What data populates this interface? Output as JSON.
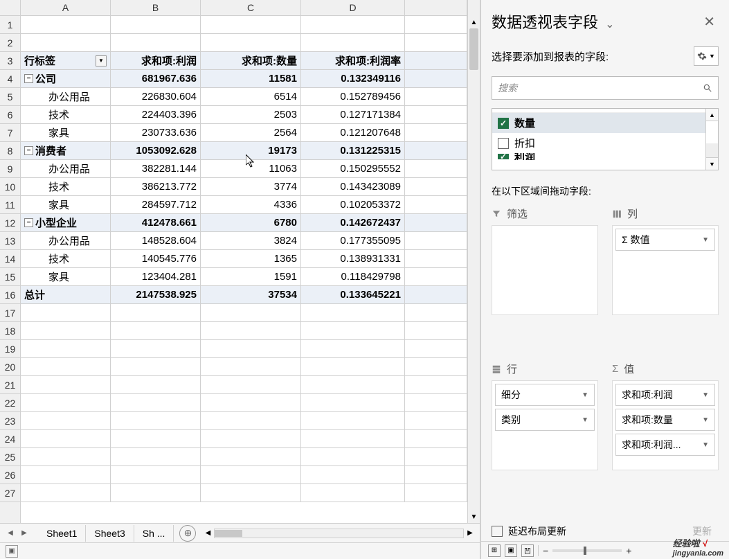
{
  "columns": [
    "A",
    "B",
    "C",
    "D"
  ],
  "row_numbers": [
    1,
    2,
    3,
    4,
    5,
    6,
    7,
    8,
    9,
    10,
    11,
    12,
    13,
    14,
    15,
    16,
    17,
    18,
    19,
    20,
    21,
    22,
    23,
    24,
    25,
    26,
    27
  ],
  "pivot": {
    "headers": {
      "A": "行标签",
      "B": "求和项:利润",
      "C": "求和项:数量",
      "D": "求和项:利润率"
    },
    "rows": [
      {
        "type": "group",
        "label": "公司",
        "b": "681967.636",
        "c": "11581",
        "d": "0.132349116"
      },
      {
        "type": "item",
        "label": "办公用品",
        "b": "226830.604",
        "c": "6514",
        "d": "0.152789456"
      },
      {
        "type": "item",
        "label": "技术",
        "b": "224403.396",
        "c": "2503",
        "d": "0.127171384"
      },
      {
        "type": "item",
        "label": "家具",
        "b": "230733.636",
        "c": "2564",
        "d": "0.121207648"
      },
      {
        "type": "group",
        "label": "消费者",
        "b": "1053092.628",
        "c": "19173",
        "d": "0.131225315"
      },
      {
        "type": "item",
        "label": "办公用品",
        "b": "382281.144",
        "c": "11063",
        "d": "0.150295552"
      },
      {
        "type": "item",
        "label": "技术",
        "b": "386213.772",
        "c": "3774",
        "d": "0.143423089"
      },
      {
        "type": "item",
        "label": "家具",
        "b": "284597.712",
        "c": "4336",
        "d": "0.102053372"
      },
      {
        "type": "group",
        "label": "小型企业",
        "b": "412478.661",
        "c": "6780",
        "d": "0.142672437"
      },
      {
        "type": "item",
        "label": "办公用品",
        "b": "148528.604",
        "c": "3824",
        "d": "0.177355095"
      },
      {
        "type": "item",
        "label": "技术",
        "b": "140545.776",
        "c": "1365",
        "d": "0.138931331"
      },
      {
        "type": "item",
        "label": "家具",
        "b": "123404.281",
        "c": "1591",
        "d": "0.118429798"
      },
      {
        "type": "total",
        "label": "总计",
        "b": "2147538.925",
        "c": "37534",
        "d": "0.133645221"
      }
    ]
  },
  "tabs": [
    "Sheet1",
    "Sheet3",
    "Sh ..."
  ],
  "sidepanel": {
    "title": "数据透视表字段",
    "subtitle": "选择要添加到报表的字段:",
    "search_placeholder": "搜索",
    "fields": [
      {
        "label": "数量",
        "checked": true,
        "selected": true
      },
      {
        "label": "折扣",
        "checked": false
      },
      {
        "label": "利润",
        "checked": true,
        "partial": true
      }
    ],
    "drag_label": "在以下区域间拖动字段:",
    "zones": {
      "filter": {
        "label": "筛选",
        "items": []
      },
      "columns": {
        "label": "列",
        "items": [
          "Σ 数值"
        ]
      },
      "rows": {
        "label": "行",
        "items": [
          "细分",
          "类别"
        ]
      },
      "values": {
        "label": "值",
        "items": [
          "求和项:利润",
          "求和项:数量",
          "求和项:利润..."
        ]
      }
    },
    "defer_label": "延迟布局更新",
    "update_label": "更新"
  },
  "watermark": {
    "brand": "经验啦",
    "check": "√",
    "domain": "jingyanla.com"
  }
}
